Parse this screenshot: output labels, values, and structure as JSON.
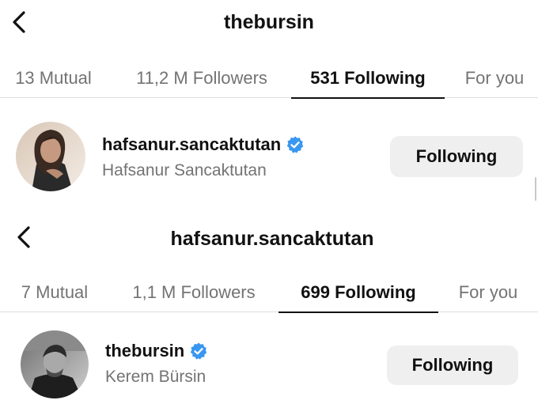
{
  "panels": [
    {
      "title": "thebursin",
      "tabs": [
        {
          "label": "13 Mutual",
          "active": false
        },
        {
          "label": "11,2 M Followers",
          "active": false
        },
        {
          "label": "531 Following",
          "active": true
        },
        {
          "label": "For you",
          "active": false
        }
      ],
      "user": {
        "username": "hafsanur.sancaktutan",
        "full_name": "Hafsanur Sancaktutan",
        "verified": true,
        "button_label": "Following"
      }
    },
    {
      "title": "hafsanur.sancaktutan",
      "tabs": [
        {
          "label": "7 Mutual",
          "active": false
        },
        {
          "label": "1,1 M Followers",
          "active": false
        },
        {
          "label": "699 Following",
          "active": true
        },
        {
          "label": "For you",
          "active": false
        }
      ],
      "user": {
        "username": "thebursin",
        "full_name": "Kerem Bürsin",
        "verified": true,
        "button_label": "Following"
      }
    }
  ],
  "icons": {
    "back": "chevron-left-icon",
    "verified": "verified-badge-icon"
  },
  "colors": {
    "verified_blue": "#3897f0",
    "secondary_text": "#737373",
    "button_bg": "#efefef",
    "divider": "#dedede"
  }
}
